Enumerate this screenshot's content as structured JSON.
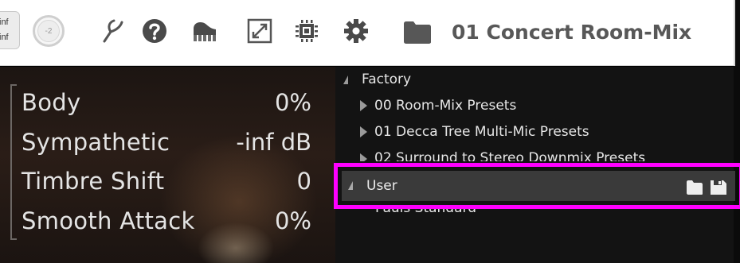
{
  "toolbar": {
    "inf_top": "inf",
    "inf_bottom": "inf",
    "knob_value": "-2",
    "preset_title": "01 Concert Room-Mix",
    "icons": [
      "tuning-fork-icon",
      "help-icon",
      "piano-icon",
      "fullscreen-icon",
      "chip-icon",
      "gear-icon",
      "folder-icon"
    ]
  },
  "params": [
    {
      "label": "Body",
      "value": "0%"
    },
    {
      "label": "Sympathetic",
      "value": "-inf dB"
    },
    {
      "label": "Timbre Shift",
      "value": "0"
    },
    {
      "label": "Smooth Attack",
      "value": "0%"
    }
  ],
  "browser": {
    "factory_label": "Factory",
    "items": [
      {
        "label": "00 Room-Mix Presets"
      },
      {
        "label": "01 Decca Tree Multi-Mic Presets"
      },
      {
        "label": "02 Surround to Stereo Downmix Presets"
      }
    ],
    "user_label": "User",
    "user_item": "Pauls Standard",
    "highlight_color": "#ff00ff"
  }
}
